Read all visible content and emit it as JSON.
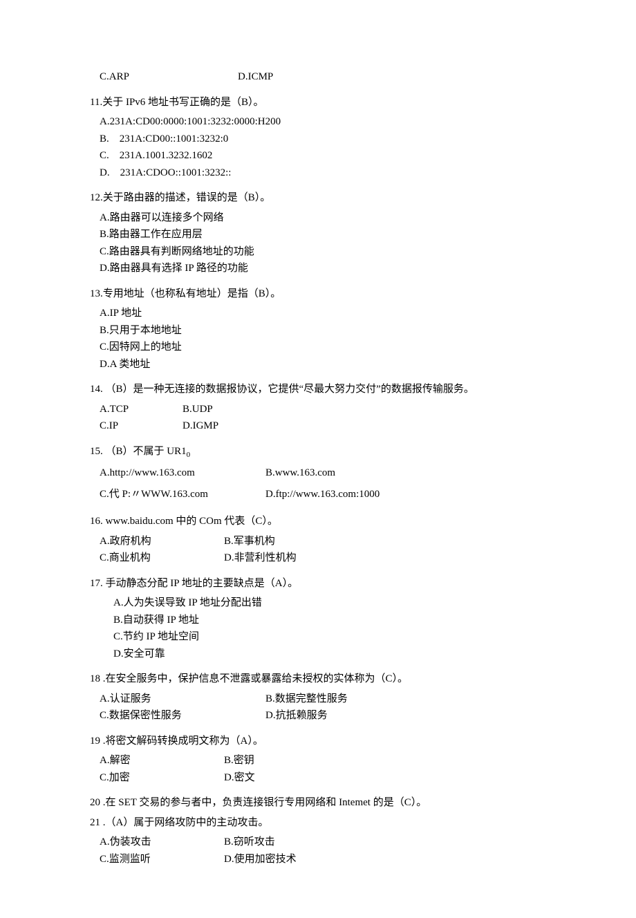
{
  "q10_tail": {
    "c": "C.ARP",
    "d": "D.ICMP"
  },
  "q11": {
    "stem": "11.关于 IPv6 地址书写正确的是（B）。",
    "a": "A.231A:CD00:0000:1001:3232:0000:H200",
    "b": "B.    231A:CD00::1001:3232:0",
    "c": "C.    231A.1001.3232.1602",
    "d": "D.    231A:CDOO::1001:3232::"
  },
  "q12": {
    "stem": "12.关于路由器的描述，错误的是（B）。",
    "a": "A.路由器可以连接多个网络",
    "b": "B.路由器工作在应用层",
    "c": "C.路由器具有判断网络地址的功能",
    "d": "D.路由器具有选择 IP 路径的功能"
  },
  "q13": {
    "stem": "13.专用地址（也称私有地址）是指（B）。",
    "a": "A.IP 地址",
    "b": "B.只用于本地地址",
    "c": "C.因特网上的地址",
    "d": "D.A 类地址"
  },
  "q14": {
    "stem": "14.   （B）是一种无连接的数据报协议，它提供“尽最大努力交付”的数据报传输服务。",
    "a": "A.TCP",
    "b": "B.UDP",
    "c": "C.IP",
    "d": "D.IGMP"
  },
  "q15": {
    "stem_pre": "15.   （B）不属于 UR1",
    "stem_sub": "0",
    "a": "A.http://www.163.com",
    "b": "B.www.163.com",
    "c": "C.代 P:〃WWW.163.com",
    "d": "D.ftp://www.163.com:1000"
  },
  "q16": {
    "stem": "16.    www.baidu.com 中的 COm 代表（C）。",
    "a": "A.政府机构",
    "b": "B.军事机构",
    "c": "C.商业机构",
    "d": "D.非营利性机构"
  },
  "q17": {
    "stem": "17.    手动静态分配 IP 地址的主要缺点是（A）。",
    "a": "A.人为失误导致 IP 地址分配出错",
    "b": "B.自动获得 IP 地址",
    "c": "C.节约 IP 地址空间",
    "d": "D.安全可靠"
  },
  "q18": {
    "stem": "18    .在安全服务中，保护信息不泄露或暴露给未授权的实体称为（C）。",
    "a": "A.认证服务",
    "b": "B.数据完整性服务",
    "c": "C.数据保密性服务",
    "d": "D.抗抵赖服务"
  },
  "q19": {
    "stem": "19    .将密文解码转换成明文称为（A）。",
    "a": "A.解密",
    "b": "B.密钥",
    "c": "C.加密",
    "d": "D.密文"
  },
  "q20": {
    "stem": "20    .在 SET 交易的参与者中，负责连接银行专用网络和 Intemet 的是（C）。"
  },
  "q21": {
    "stem": "21    .（A）属于网络攻防中的主动攻击。",
    "a": "A.伪装攻击",
    "b": "B.窃听攻击",
    "c": "C.监测监听",
    "d": "D.使用加密技术"
  }
}
